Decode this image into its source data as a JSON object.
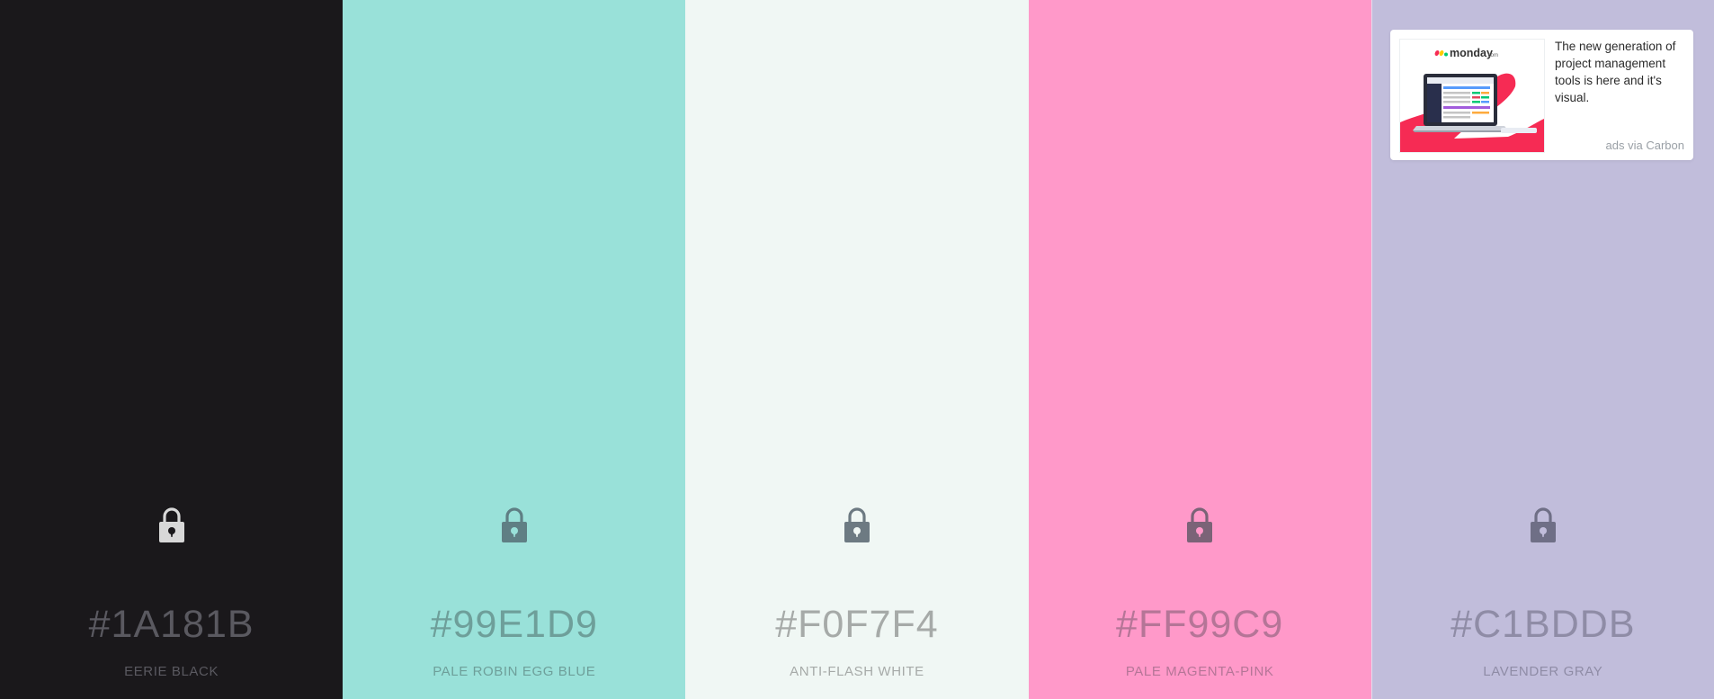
{
  "palette": {
    "swatches": [
      {
        "hex": "#1A181B",
        "name": "EERIE BLACK",
        "bg": "#1a181b",
        "text_color": "#5a5960",
        "lock_color": "#d8d8d8",
        "lock_hole": "#1a181b"
      },
      {
        "hex": "#99E1D9",
        "name": "PALE ROBIN EGG BLUE",
        "bg": "#99e1d9",
        "text_color": "#6e9f9a",
        "lock_color": "#5f7f84",
        "lock_hole": "#99e1d9"
      },
      {
        "hex": "#F0F7F4",
        "name": "ANTI-FLASH WHITE",
        "bg": "#f0f7f4",
        "text_color": "#a6aaa8",
        "lock_color": "#6d7a82",
        "lock_hole": "#f0f7f4"
      },
      {
        "hex": "#FF99C9",
        "name": "PALE MAGENTA-PINK",
        "bg": "#ff99c9",
        "text_color": "#b57597",
        "lock_color": "#7b6377",
        "lock_hole": "#ff99c9"
      },
      {
        "hex": "#C1BDDB",
        "name": "LAVENDER GRAY",
        "bg": "#c1bddb",
        "text_color": "#8f8ca6",
        "lock_color": "#6f6f86",
        "lock_hole": "#c1bddb"
      }
    ]
  },
  "ad": {
    "brand": "monday",
    "brand_suffix": ".com",
    "text": "The new generation of project management tools is here and it's visual.",
    "via": "ads via Carbon",
    "accent": "#f62b54"
  }
}
